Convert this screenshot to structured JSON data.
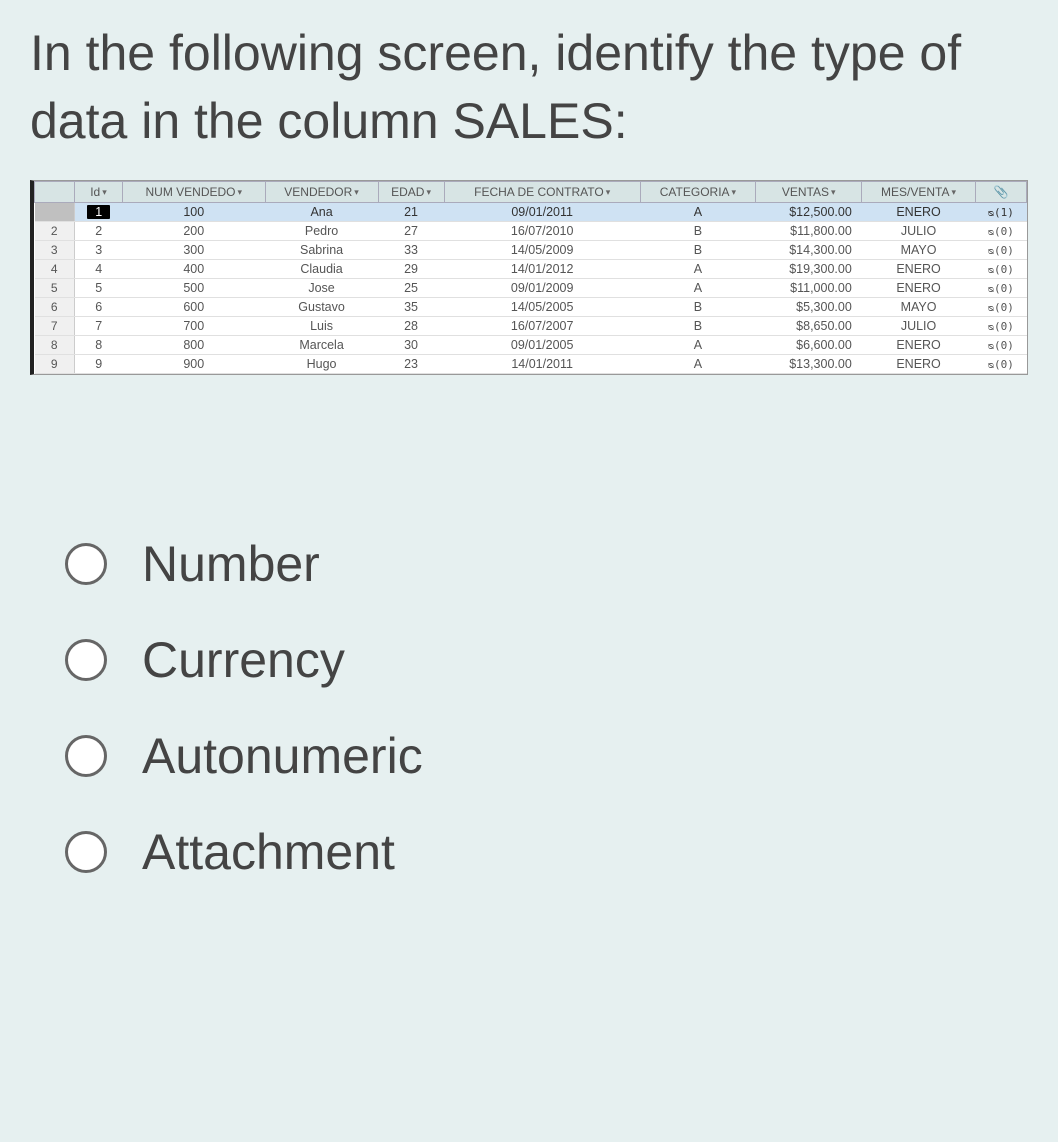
{
  "question": "In the following screen, identify the type of data in the column SALES:",
  "columns": {
    "rownum": "",
    "id": "Id",
    "num_vendedo": "NUM VENDEDO",
    "vendedor": "VENDEDOR",
    "edad": "EDAD",
    "fecha": "FECHA DE CONTRATO",
    "categoria": "CATEGORIA",
    "ventas": "VENTAS",
    "mes_venta": "MES/VENTA",
    "clip": ""
  },
  "clip_header_icon": "📎",
  "dropdown_glyph": "▾",
  "rows": [
    {
      "rownum": "",
      "id": "1",
      "num": "100",
      "ven": "Ana",
      "edad": "21",
      "fecha": "09/01/2011",
      "cat": "A",
      "ventas": "$12,500.00",
      "mes": "ENERO",
      "att": "ᴓ(1)",
      "sel": true
    },
    {
      "rownum": "2",
      "id": "2",
      "num": "200",
      "ven": "Pedro",
      "edad": "27",
      "fecha": "16/07/2010",
      "cat": "B",
      "ventas": "$11,800.00",
      "mes": "JULIO",
      "att": "ᴓ(0)",
      "sel": false
    },
    {
      "rownum": "3",
      "id": "3",
      "num": "300",
      "ven": "Sabrina",
      "edad": "33",
      "fecha": "14/05/2009",
      "cat": "B",
      "ventas": "$14,300.00",
      "mes": "MAYO",
      "att": "ᴓ(0)",
      "sel": false
    },
    {
      "rownum": "4",
      "id": "4",
      "num": "400",
      "ven": "Claudia",
      "edad": "29",
      "fecha": "14/01/2012",
      "cat": "A",
      "ventas": "$19,300.00",
      "mes": "ENERO",
      "att": "ᴓ(0)",
      "sel": false
    },
    {
      "rownum": "5",
      "id": "5",
      "num": "500",
      "ven": "Jose",
      "edad": "25",
      "fecha": "09/01/2009",
      "cat": "A",
      "ventas": "$11,000.00",
      "mes": "ENERO",
      "att": "ᴓ(0)",
      "sel": false
    },
    {
      "rownum": "6",
      "id": "6",
      "num": "600",
      "ven": "Gustavo",
      "edad": "35",
      "fecha": "14/05/2005",
      "cat": "B",
      "ventas": "$5,300.00",
      "mes": "MAYO",
      "att": "ᴓ(0)",
      "sel": false
    },
    {
      "rownum": "7",
      "id": "7",
      "num": "700",
      "ven": "Luis",
      "edad": "28",
      "fecha": "16/07/2007",
      "cat": "B",
      "ventas": "$8,650.00",
      "mes": "JULIO",
      "att": "ᴓ(0)",
      "sel": false
    },
    {
      "rownum": "8",
      "id": "8",
      "num": "800",
      "ven": "Marcela",
      "edad": "30",
      "fecha": "09/01/2005",
      "cat": "A",
      "ventas": "$6,600.00",
      "mes": "ENERO",
      "att": "ᴓ(0)",
      "sel": false
    },
    {
      "rownum": "9",
      "id": "9",
      "num": "900",
      "ven": "Hugo",
      "edad": "23",
      "fecha": "14/01/2011",
      "cat": "A",
      "ventas": "$13,300.00",
      "mes": "ENERO",
      "att": "ᴓ(0)",
      "sel": false
    }
  ],
  "options": [
    {
      "label": "Number"
    },
    {
      "label": "Currency"
    },
    {
      "label": "Autonumeric"
    },
    {
      "label": "Attachment"
    }
  ]
}
